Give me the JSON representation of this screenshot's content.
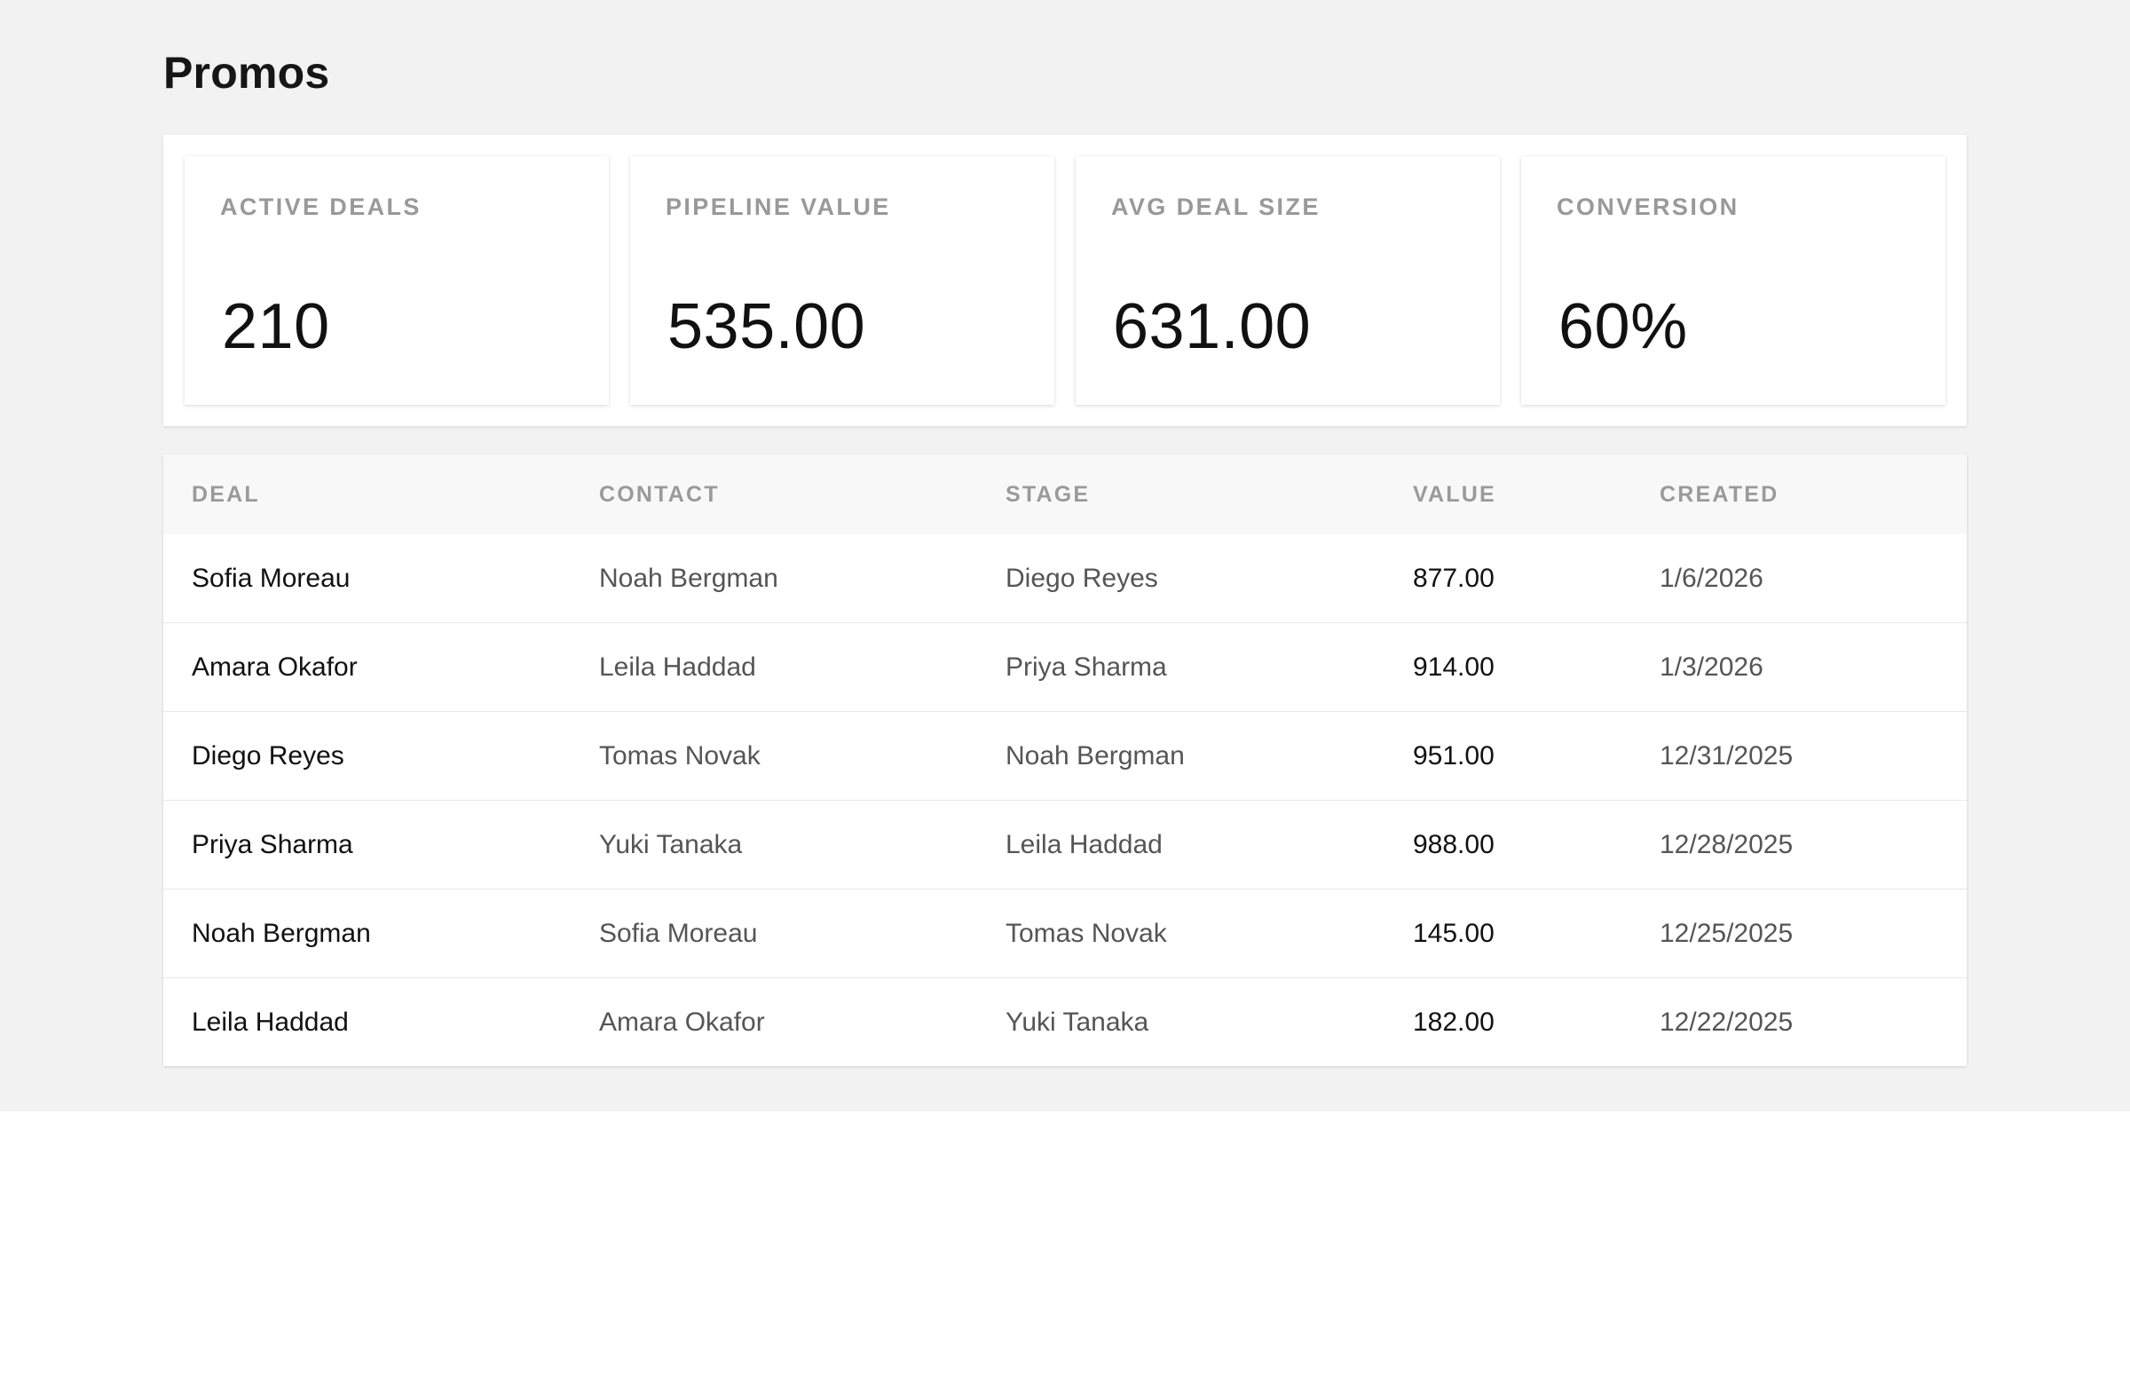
{
  "page": {
    "title": "Promos"
  },
  "stats": [
    {
      "label": "ACTIVE DEALS",
      "value": "210"
    },
    {
      "label": "PIPELINE VALUE",
      "value": "535.00"
    },
    {
      "label": "AVG DEAL SIZE",
      "value": "631.00"
    },
    {
      "label": "CONVERSION",
      "value": "60%"
    }
  ],
  "table": {
    "columns": [
      "DEAL",
      "CONTACT",
      "STAGE",
      "VALUE",
      "CREATED"
    ],
    "rows": [
      {
        "deal": "Sofia Moreau",
        "contact": "Noah Bergman",
        "stage": "Diego Reyes",
        "value": "877.00",
        "created": "1/6/2026"
      },
      {
        "deal": "Amara Okafor",
        "contact": "Leila Haddad",
        "stage": "Priya Sharma",
        "value": "914.00",
        "created": "1/3/2026"
      },
      {
        "deal": "Diego Reyes",
        "contact": "Tomas Novak",
        "stage": "Noah Bergman",
        "value": "951.00",
        "created": "12/31/2025"
      },
      {
        "deal": "Priya Sharma",
        "contact": "Yuki Tanaka",
        "stage": "Leila Haddad",
        "value": "988.00",
        "created": "12/28/2025"
      },
      {
        "deal": "Noah Bergman",
        "contact": "Sofia Moreau",
        "stage": "Tomas Novak",
        "value": "145.00",
        "created": "12/25/2025"
      },
      {
        "deal": "Leila Haddad",
        "contact": "Amara Okafor",
        "stage": "Yuki Tanaka",
        "value": "182.00",
        "created": "12/22/2025"
      }
    ]
  }
}
